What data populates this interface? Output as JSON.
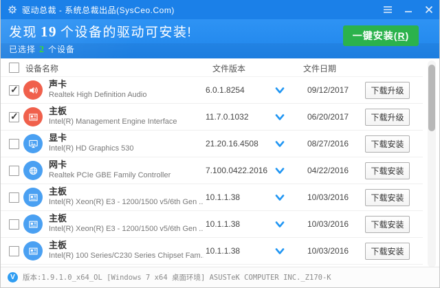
{
  "window": {
    "title": "驱动总裁 - 系统总裁出品(SysCeo.Com)"
  },
  "icons": {
    "app": "gear-clock-icon",
    "titlebar": [
      "menu-icon",
      "minimize-icon",
      "close-icon"
    ],
    "version_badge": "version-badge-icon",
    "version_badge_glyph": "V"
  },
  "header": {
    "headline_prefix": "发现",
    "device_count": "19",
    "headline_suffix": "个设备的驱动可安装!",
    "selected_prefix": "已选择",
    "selected_count": "2",
    "selected_suffix": "个设备",
    "install_button": {
      "prefix": "一键安装(",
      "hotkey": "R",
      "suffix": ")"
    }
  },
  "table": {
    "columns": {
      "name": "设备名称",
      "version": "文件版本",
      "date": "文件日期"
    },
    "rows": [
      {
        "checked": true,
        "icon": "speaker-icon",
        "icon_color": "#f0604c",
        "category": "声卡",
        "device": "Realtek High Definition Audio",
        "version": "6.0.1.8254",
        "date": "09/12/2017",
        "action": "下载升级"
      },
      {
        "checked": true,
        "icon": "motherboard-icon",
        "icon_color": "#f0604c",
        "category": "主板",
        "device": "Intel(R) Management Engine Interface",
        "version": "11.7.0.1032",
        "date": "06/20/2017",
        "action": "下载升级"
      },
      {
        "checked": false,
        "icon": "monitor-icon",
        "icon_color": "#4aa0f2",
        "category": "显卡",
        "device": "Intel(R) HD Graphics 530",
        "version": "21.20.16.4508",
        "date": "08/27/2016",
        "action": "下载安装"
      },
      {
        "checked": false,
        "icon": "globe-icon",
        "icon_color": "#4aa0f2",
        "category": "网卡",
        "device": "Realtek PCIe GBE Family Controller",
        "version": "7.100.0422.2016",
        "date": "04/22/2016",
        "action": "下载安装"
      },
      {
        "checked": false,
        "icon": "motherboard-icon",
        "icon_color": "#4aa0f2",
        "category": "主板",
        "device": "Intel(R) Xeon(R) E3 - 1200/1500 v5/6th Gen ...",
        "version": "10.1.1.38",
        "date": "10/03/2016",
        "action": "下载安装"
      },
      {
        "checked": false,
        "icon": "motherboard-icon",
        "icon_color": "#4aa0f2",
        "category": "主板",
        "device": "Intel(R) Xeon(R) E3 - 1200/1500 v5/6th Gen ...",
        "version": "10.1.1.38",
        "date": "10/03/2016",
        "action": "下载安装"
      },
      {
        "checked": false,
        "icon": "motherboard-icon",
        "icon_color": "#4aa0f2",
        "category": "主板",
        "device": "Intel(R) 100 Series/C230 Series Chipset Fam...",
        "version": "10.1.1.38",
        "date": "10/03/2016",
        "action": "下载安装"
      }
    ]
  },
  "statusbar": {
    "text": "版本:1.9.1.0_x64_OL [Windows 7 x64 桌面环境] ASUSTeK COMPUTER INC._Z170-K"
  },
  "colors": {
    "titlebar_blue": "#1b80e8",
    "header_top": "#2e93f4",
    "header_bottom": "#1f85ea",
    "accent_green": "#2bb24c",
    "count_green": "#3ade2e",
    "icon_red": "#f0604c",
    "icon_blue": "#4aa0f2",
    "chevron_blue": "#2196f3",
    "badge_blue": "#2f9df2"
  }
}
